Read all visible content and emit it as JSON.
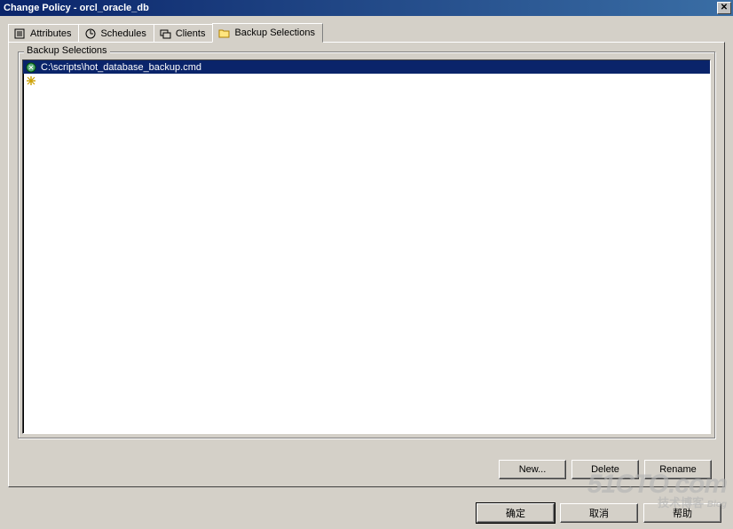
{
  "window": {
    "title": "Change Policy - orcl_oracle_db",
    "close_glyph": "✕"
  },
  "tabs": [
    {
      "label": "Attributes",
      "icon": "attributes-icon"
    },
    {
      "label": "Schedules",
      "icon": "schedules-icon"
    },
    {
      "label": "Clients",
      "icon": "clients-icon"
    },
    {
      "label": "Backup Selections",
      "icon": "backup-selections-icon",
      "active": true
    }
  ],
  "groupbox": {
    "label": "Backup Selections"
  },
  "list": {
    "items": [
      {
        "path": "C:\\scripts\\hot_database_backup.cmd",
        "icon": "script-icon",
        "selected": true
      },
      {
        "path": "",
        "icon": "new-item-icon",
        "selected": false
      }
    ]
  },
  "actions": {
    "new": "New...",
    "delete": "Delete",
    "rename": "Rename"
  },
  "footer": {
    "ok": "确定",
    "cancel": "取消",
    "help": "帮助"
  },
  "watermark": {
    "line1": "51CTO.com",
    "line2": "技术博客",
    "line3": "Blog"
  }
}
